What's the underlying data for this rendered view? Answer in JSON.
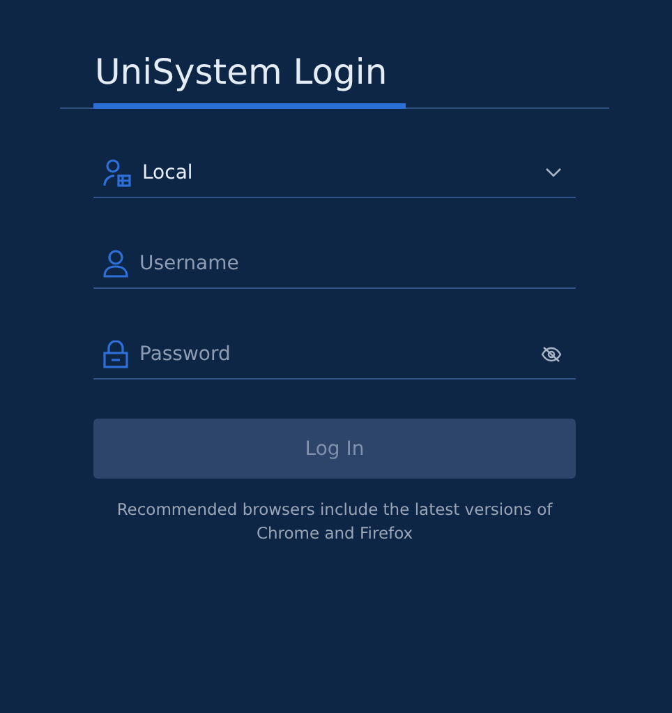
{
  "tabs": [
    {
      "label": "UniSystem Login",
      "selected": true
    }
  ],
  "login_type": {
    "value": "Local"
  },
  "username": {
    "placeholder": "Username"
  },
  "password": {
    "placeholder": "Password"
  },
  "login_button": {
    "label": "Log In",
    "disabled": true
  },
  "note": "Recommended browsers include the latest versions of Chrome and Firefox"
}
